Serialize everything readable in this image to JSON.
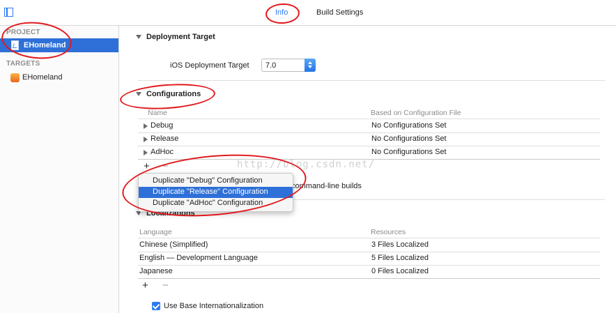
{
  "tabs": [
    {
      "label": "Info",
      "active": true
    },
    {
      "label": "Build Settings",
      "active": false
    }
  ],
  "sidebar": {
    "project_header": "PROJECT",
    "project_item": "EHomeland",
    "targets_header": "TARGETS",
    "target_item": "EHomeland"
  },
  "deployment": {
    "title": "Deployment Target",
    "label": "iOS Deployment Target",
    "value": "7.0"
  },
  "configurations": {
    "title": "Configurations",
    "columns": [
      "Name",
      "Based on Configuration File"
    ],
    "rows": [
      {
        "name": "Debug",
        "file": "No Configurations Set"
      },
      {
        "name": "Release",
        "file": "No Configurations Set"
      },
      {
        "name": "AdHoc",
        "file": "No Configurations Set"
      }
    ],
    "partial_text": "command-line builds"
  },
  "popup_menu": {
    "items": [
      {
        "label": "Duplicate \"Debug\" Configuration",
        "selected": false
      },
      {
        "label": "Duplicate \"Release\" Configuration",
        "selected": true
      },
      {
        "label": "Duplicate \"AdHoc\" Configuration",
        "selected": false
      }
    ]
  },
  "localizations": {
    "title": "Localizations",
    "columns": [
      "Language",
      "Resources"
    ],
    "rows": [
      {
        "language": "Chinese (Simplified)",
        "resources": "3 Files Localized"
      },
      {
        "language": "English — Development Language",
        "resources": "5 Files Localized"
      },
      {
        "language": "Japanese",
        "resources": "0 Files Localized"
      }
    ],
    "base_internationalization_label": "Use Base Internationalization",
    "base_internationalization_checked": true
  },
  "controls": {
    "plus": "+",
    "minus": "−"
  },
  "watermark": "http://blog.csdn.net/",
  "colors": {
    "accent": "#2d7bf4",
    "selection": "#2e70d8",
    "annotation": "#e0191d"
  }
}
